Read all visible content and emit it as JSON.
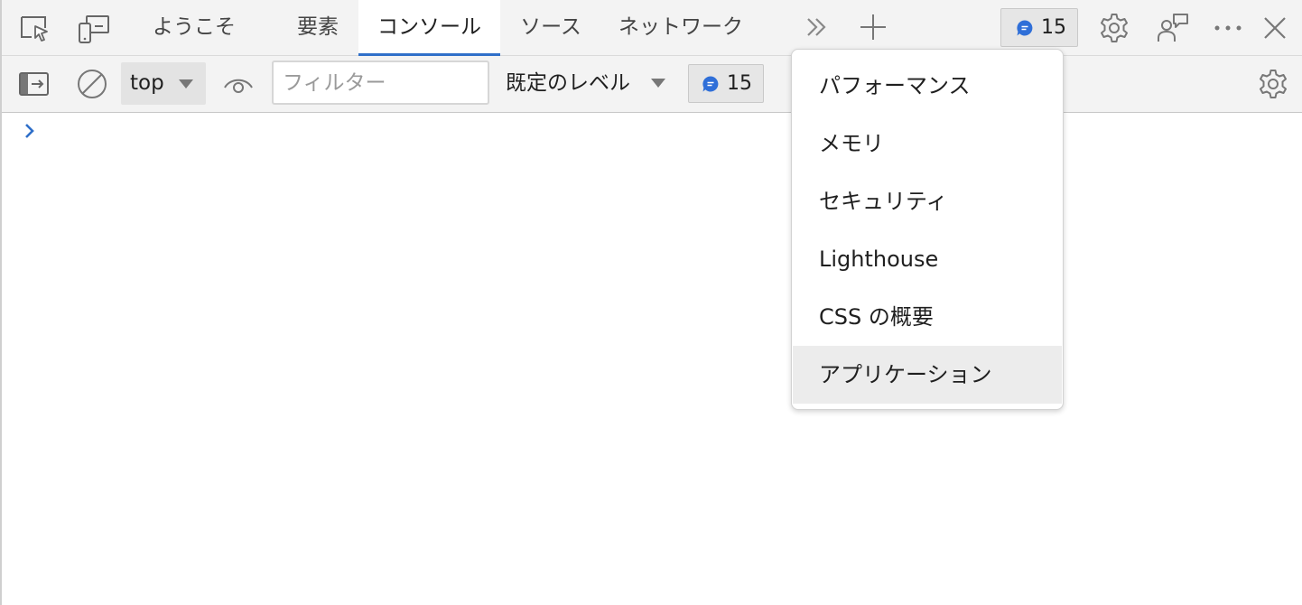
{
  "toolbar_top": {
    "inspect_icon": "inspect-element-icon",
    "device_icon": "device-emulation-icon",
    "tabs": [
      {
        "label": "ようこそ",
        "active": false
      },
      {
        "label": "要素",
        "active": false
      },
      {
        "label": "コンソール",
        "active": true
      },
      {
        "label": "ソース",
        "active": false
      },
      {
        "label": "ネットワーク",
        "active": false
      }
    ],
    "more_tabs_icon": "double-chevron-right-icon",
    "add_tab_icon": "plus-icon",
    "issues_count": "15",
    "settings_icon": "gear-icon",
    "feedback_icon": "feedback-icon",
    "more_icon": "ellipsis-icon",
    "close_icon": "close-icon"
  },
  "console_toolbar": {
    "sidebar_icon": "sidebar-toggle-icon",
    "clear_icon": "clear-console-icon",
    "context": "top",
    "live_expression_icon": "eye-icon",
    "filter_placeholder": "フィルター",
    "filter_value": "",
    "levels_label": "既定のレベル",
    "issues_count": "15",
    "settings_icon": "gear-icon"
  },
  "console": {
    "prompt_icon": "chevron-right-icon"
  },
  "more_tools_menu": {
    "items": [
      {
        "label": "パフォーマンス",
        "highlighted": false
      },
      {
        "label": "メモリ",
        "highlighted": false
      },
      {
        "label": "セキュリティ",
        "highlighted": false
      },
      {
        "label": "Lighthouse",
        "highlighted": false
      },
      {
        "label": "CSS の概要",
        "highlighted": false
      },
      {
        "label": "アプリケーション",
        "highlighted": true
      }
    ]
  },
  "colors": {
    "accent": "#2f6fc9",
    "toolbar_bg": "#f3f3f3",
    "issue_blue": "#2f6fd8",
    "menu_highlight": "#ececec"
  }
}
